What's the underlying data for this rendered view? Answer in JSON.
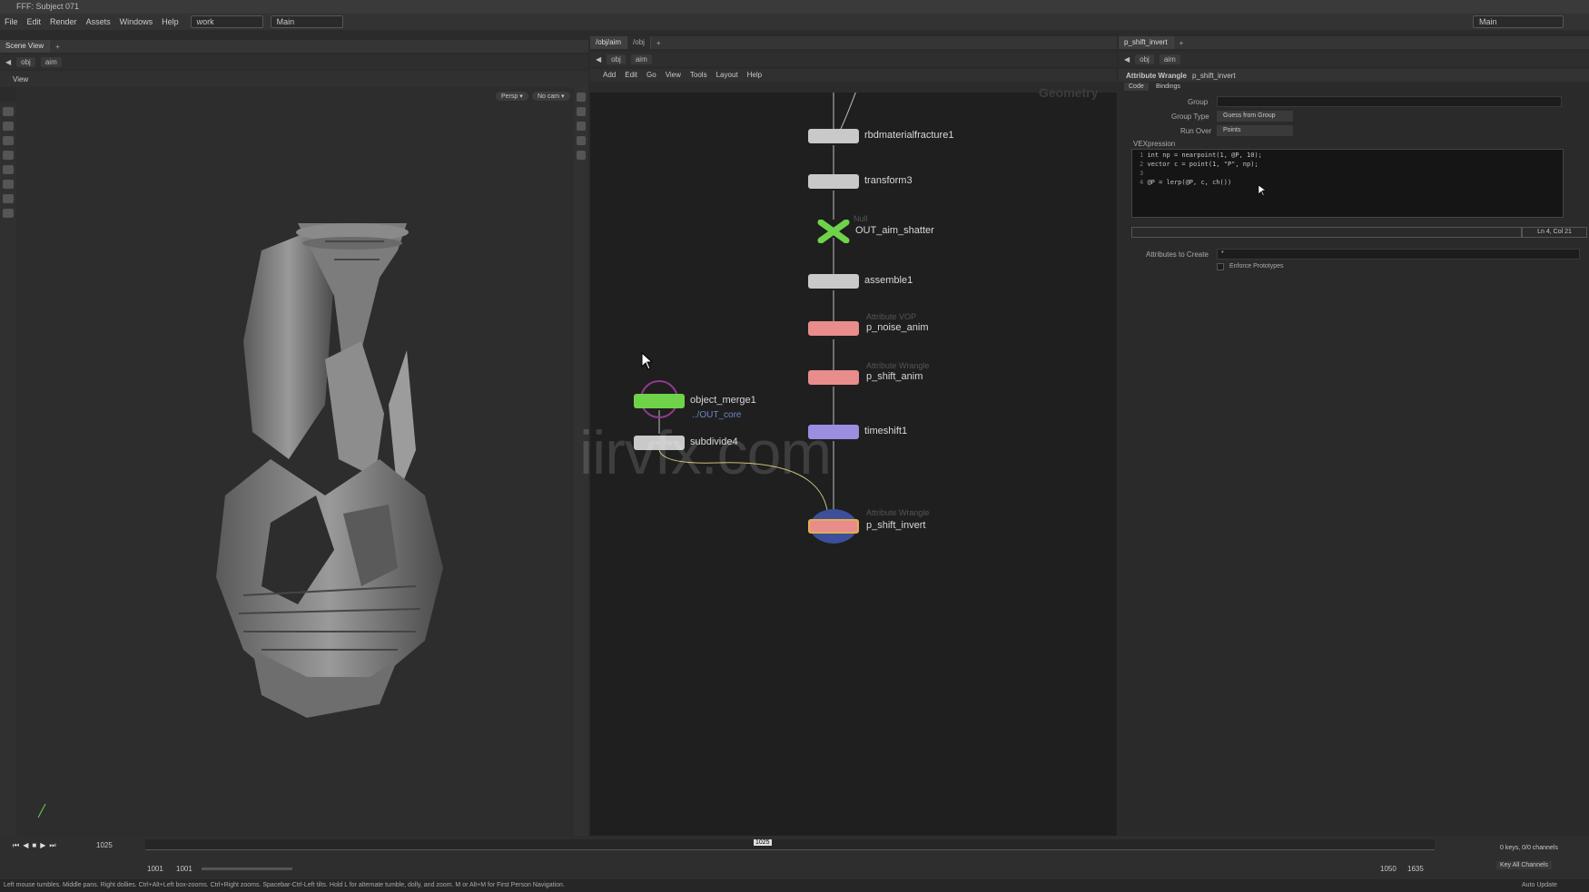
{
  "window": {
    "title": "FFF: Subject 071"
  },
  "menu": [
    "File",
    "Edit",
    "Render",
    "Assets",
    "Windows",
    "Help"
  ],
  "desktop": {
    "name": "work",
    "workspace": "Main",
    "right_label": "Main"
  },
  "scene_view": {
    "tab": "Scene View",
    "path": [
      "obj",
      "aim"
    ],
    "view_label": "View",
    "persp_btn": "Persp ▾",
    "cam_btn": "No cam ▾"
  },
  "network": {
    "tabs": [
      "/obj/aim",
      "/obj"
    ],
    "path": [
      "obj",
      "aim"
    ],
    "menu": [
      "Add",
      "Edit",
      "Go",
      "View",
      "Tools",
      "Layout",
      "Help"
    ],
    "context_label": "Geometry",
    "watermark": "iirvfx.com",
    "nodes": [
      {
        "type": "",
        "name": "rbdmaterialfracture1",
        "color": "#c9c9c9"
      },
      {
        "type": "",
        "name": "transform3",
        "color": "#c9c9c9"
      },
      {
        "type": "Null",
        "name": "OUT_aim_shatter",
        "color": "#6fd34a"
      },
      {
        "type": "",
        "name": "assemble1",
        "color": "#c9c9c9"
      },
      {
        "type": "Attribute VOP",
        "name": "p_noise_anim",
        "color": "#e98c8c"
      },
      {
        "type": "Attribute Wrangle",
        "name": "p_shift_anim",
        "color": "#e98c8c"
      },
      {
        "type": "",
        "name": "timeshift1",
        "color": "#9b8de0"
      },
      {
        "type": "Attribute Wrangle",
        "name": "p_shift_invert",
        "color": "#e98c8c"
      },
      {
        "type": "",
        "name": "object_merge1",
        "sub": "../OUT_core",
        "color": "#6fd34a"
      },
      {
        "type": "",
        "name": "subdivide4",
        "color": "#c9c9c9"
      }
    ]
  },
  "params": {
    "tab": "p_shift_invert",
    "path": [
      "obj",
      "aim"
    ],
    "node_type": "Attribute Wrangle",
    "node_name": "p_shift_invert",
    "subtabs": [
      "Code",
      "Bindings"
    ],
    "group_label": "Group",
    "group_type_label": "Group Type",
    "group_type_value": "Guess from Group",
    "run_over_label": "Run Over",
    "run_over_value": "Points",
    "vex_label": "VEXpression",
    "code_lines": [
      {
        "n": "1",
        "text": "int np = nearpoint(1, @P, 10);"
      },
      {
        "n": "2",
        "text": "vector c = point(1, \"P\", np);"
      },
      {
        "n": "3",
        "text": ""
      },
      {
        "n": "4",
        "text": "@P = lerp(@P, c, ch())"
      }
    ],
    "cursor_pos": "Ln 4, Col 21",
    "attr_create_label": "Attributes to Create",
    "attr_create_value": "*",
    "enforce_label": "Enforce Prototypes"
  },
  "timeline": {
    "current_frame": "1025",
    "start": "1001",
    "start2": "1001",
    "end": "1050",
    "end2": "1635",
    "marker": "1025",
    "keys_label": "0 keys, 0/0 channels",
    "key_all": "Key All Channels",
    "auto_update": "Auto Update"
  },
  "status": "Left mouse tumbles. Middle pans. Right dollies. Ctrl+Alt+Left box-zooms. Ctrl+Right zooms. Spacebar-Ctrl-Left tilts. Hold L for alternate tumble, dolly, and zoom.    M or Alt+M for First Person Navigation."
}
